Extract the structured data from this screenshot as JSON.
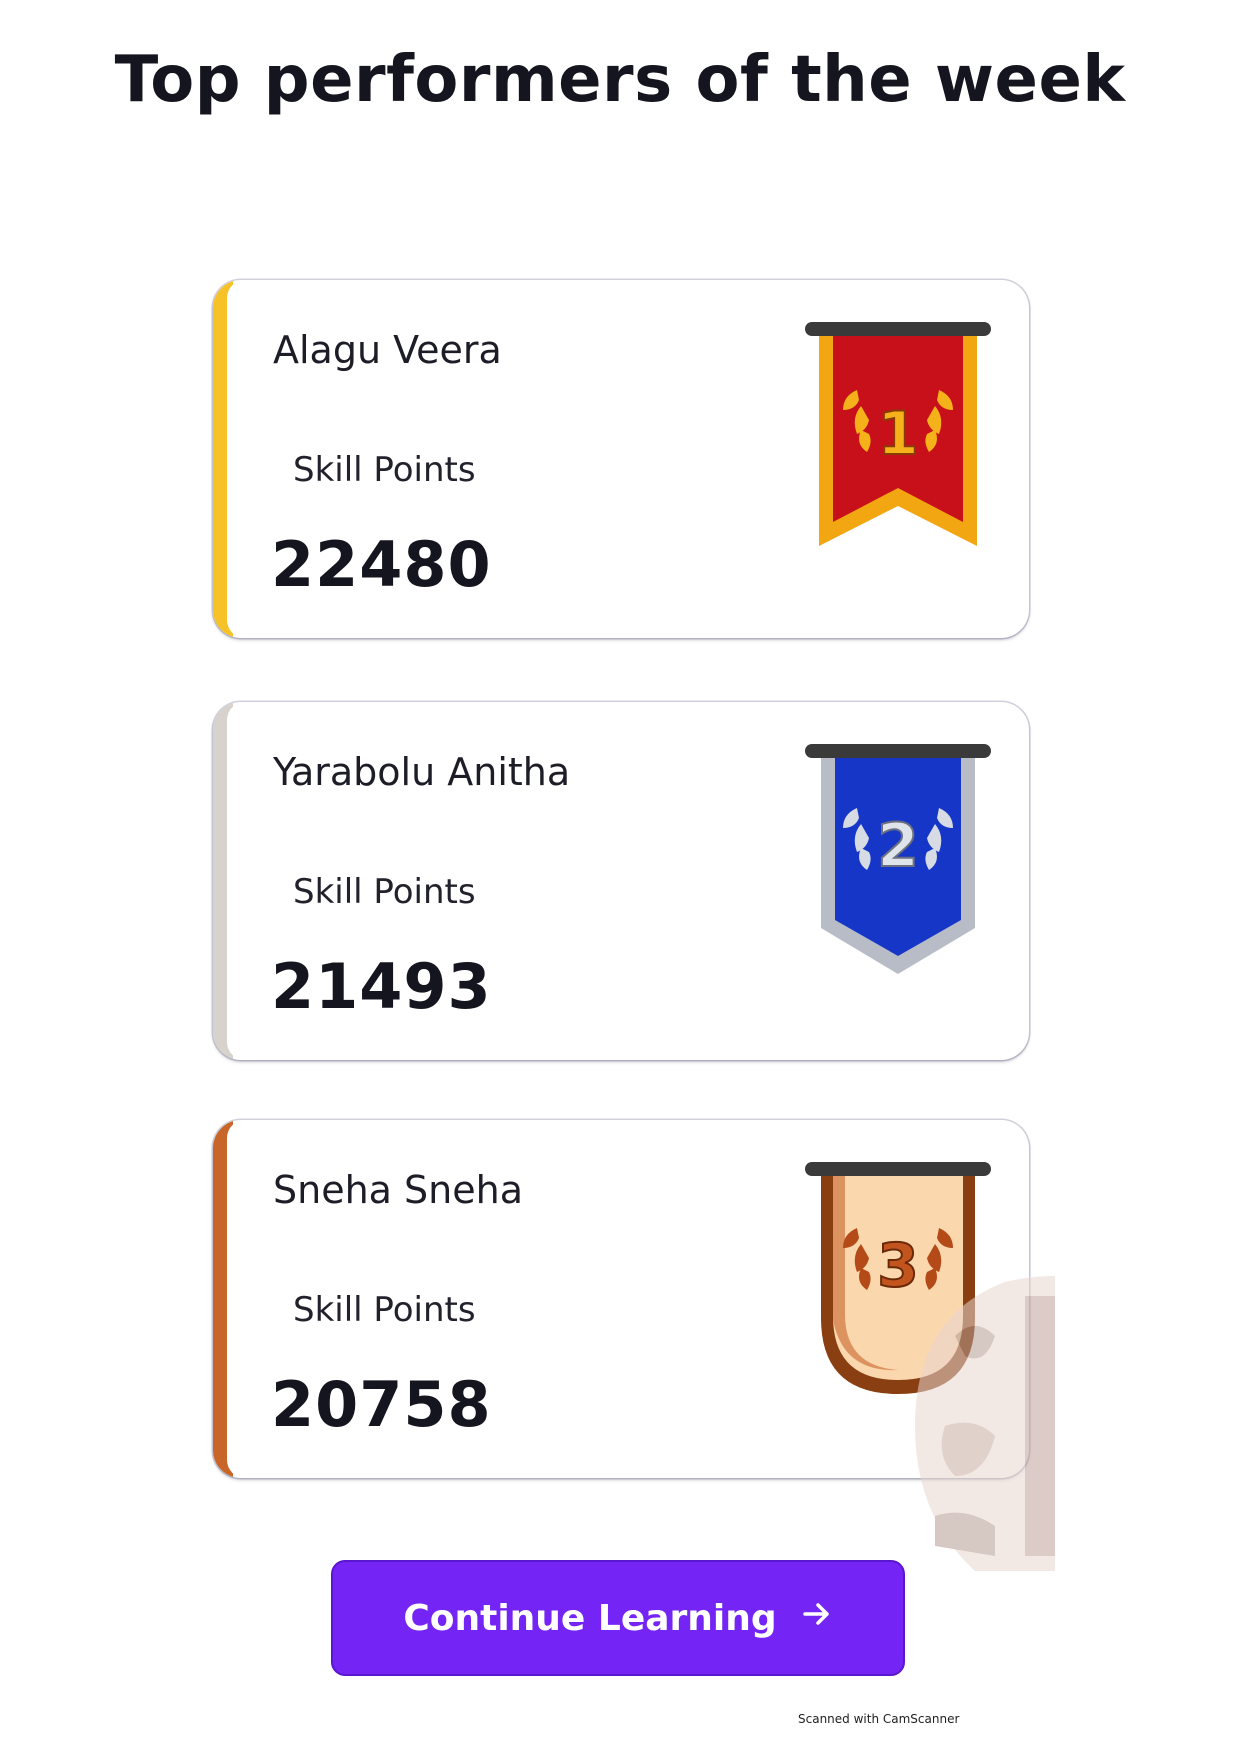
{
  "page": {
    "title": "Top performers of the week"
  },
  "performers": [
    {
      "rank": "1",
      "name": "Alagu Veera",
      "points_label": "Skill Points",
      "points": "22480",
      "accent_color": "#f6c227",
      "ribbon_color": "#c8101a",
      "ribbon_border": "#f2a612",
      "medal_icon": "gold-ribbon-icon"
    },
    {
      "rank": "2",
      "name": "Yarabolu Anitha",
      "points_label": "Skill Points",
      "points": "21493",
      "accent_color": "#d8d2cc",
      "ribbon_color": "#1636c8",
      "ribbon_border": "#b8bcc6",
      "medal_icon": "silver-ribbon-icon"
    },
    {
      "rank": "3",
      "name": "Sneha Sneha",
      "points_label": "Skill Points",
      "points": "20758",
      "accent_color": "#c8662a",
      "ribbon_color": "#fbd7ae",
      "ribbon_border": "#8a3f12",
      "medal_icon": "bronze-ribbon-icon"
    }
  ],
  "cta": {
    "label": "Continue Learning",
    "icon": "arrow-right-icon",
    "color": "#7424f4"
  },
  "footer": {
    "scanned_note": "Scanned with CamScanner"
  }
}
